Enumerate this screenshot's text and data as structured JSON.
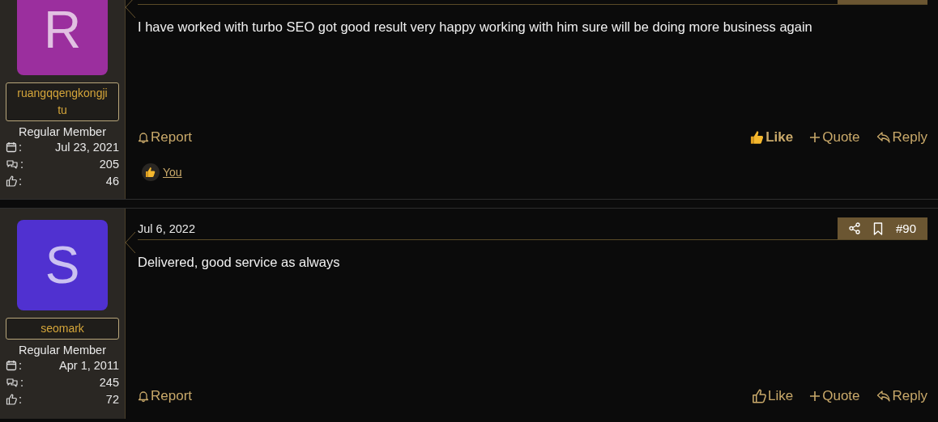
{
  "stat_separator": ":",
  "posts": [
    {
      "author": "ruangqqengkongjitu",
      "avatar_letter": "R",
      "color": "#9b2f9e",
      "role": "Regular Member",
      "joined": "Jul 23, 2021",
      "messages": "205",
      "reactions": "46",
      "body": "I have worked with turbo SEO got good result very happy working with him sure will be doing more business again",
      "actions": {
        "report": "Report",
        "like": "Like",
        "quote": "Quote",
        "reply": "Reply"
      },
      "liked": true,
      "likes_list": [
        "You"
      ]
    },
    {
      "author": "seomark",
      "avatar_letter": "S",
      "color": "#5031d0",
      "role": "Regular Member",
      "joined": "Apr 1, 2011",
      "messages": "245",
      "reactions": "72",
      "date": "Jul 6, 2022",
      "post_number": "#90",
      "body": "Delivered, good service as always",
      "actions": {
        "report": "Report",
        "like": "Like",
        "quote": "Quote",
        "reply": "Reply"
      },
      "liked": false
    }
  ]
}
